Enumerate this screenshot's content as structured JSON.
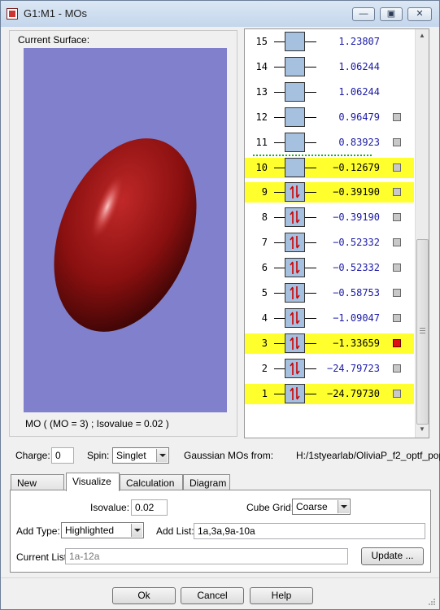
{
  "window": {
    "title": "G1:M1 - MOs",
    "minimize_glyph": "—",
    "maximize_glyph": "▣",
    "close_glyph": "✕"
  },
  "surface": {
    "label": "Current Surface:",
    "caption": "MO ( (MO = 3) ; Isovalue = 0.02 )",
    "background_color": "#8080cc",
    "lobe_color": "#8b1010"
  },
  "orbitals": [
    {
      "number": "15",
      "energy": "1.23807",
      "occupied": false,
      "highlighted": false,
      "checkbox": false,
      "selected": false
    },
    {
      "number": "14",
      "energy": "1.06244",
      "occupied": false,
      "highlighted": false,
      "checkbox": false,
      "selected": false
    },
    {
      "number": "13",
      "energy": "1.06244",
      "occupied": false,
      "highlighted": false,
      "checkbox": false,
      "selected": false
    },
    {
      "number": "12",
      "energy": "0.96479",
      "occupied": false,
      "highlighted": false,
      "checkbox": true,
      "selected": false
    },
    {
      "number": "11",
      "energy": "0.83923",
      "occupied": false,
      "highlighted": false,
      "checkbox": true,
      "selected": false
    },
    {
      "number": "10",
      "energy": "−0.12679",
      "occupied": false,
      "highlighted": true,
      "checkbox": true,
      "selected": false
    },
    {
      "number": "9",
      "energy": "−0.39190",
      "occupied": true,
      "highlighted": true,
      "checkbox": true,
      "selected": false
    },
    {
      "number": "8",
      "energy": "−0.39190",
      "occupied": true,
      "highlighted": false,
      "checkbox": true,
      "selected": false
    },
    {
      "number": "7",
      "energy": "−0.52332",
      "occupied": true,
      "highlighted": false,
      "checkbox": true,
      "selected": false
    },
    {
      "number": "6",
      "energy": "−0.52332",
      "occupied": true,
      "highlighted": false,
      "checkbox": true,
      "selected": false
    },
    {
      "number": "5",
      "energy": "−0.58753",
      "occupied": true,
      "highlighted": false,
      "checkbox": true,
      "selected": false
    },
    {
      "number": "4",
      "energy": "−1.09047",
      "occupied": true,
      "highlighted": false,
      "checkbox": true,
      "selected": false
    },
    {
      "number": "3",
      "energy": "−1.33659",
      "occupied": true,
      "highlighted": true,
      "checkbox": true,
      "selected": true
    },
    {
      "number": "2",
      "energy": "−24.79723",
      "occupied": true,
      "highlighted": false,
      "checkbox": true,
      "selected": false
    },
    {
      "number": "1",
      "energy": "−24.79730",
      "occupied": true,
      "highlighted": true,
      "checkbox": true,
      "selected": false
    }
  ],
  "charge": {
    "label": "Charge:",
    "value": "0"
  },
  "spin": {
    "label": "Spin:",
    "value": "Singlet"
  },
  "source": {
    "label": "Gaussian MOs from:",
    "path": "H:/1styearlab/OliviaP_f2_optf_pop."
  },
  "tabs": [
    "New MOs",
    "Visualize",
    "Calculation",
    "Diagram"
  ],
  "active_tab": "Visualize",
  "visualize": {
    "isovalue_label": "Isovalue:",
    "isovalue": "0.02",
    "cube_grid_label": "Cube Grid:",
    "cube_grid": "Coarse",
    "add_type_label": "Add Type:",
    "add_type": "Highlighted",
    "add_list_label": "Add List:",
    "add_list": "1a,3a,9a-10a",
    "current_list_label": "Current List:",
    "current_list": "1a-12a",
    "update_button": "Update ..."
  },
  "buttons": {
    "ok": "Ok",
    "cancel": "Cancel",
    "help": "Help"
  }
}
